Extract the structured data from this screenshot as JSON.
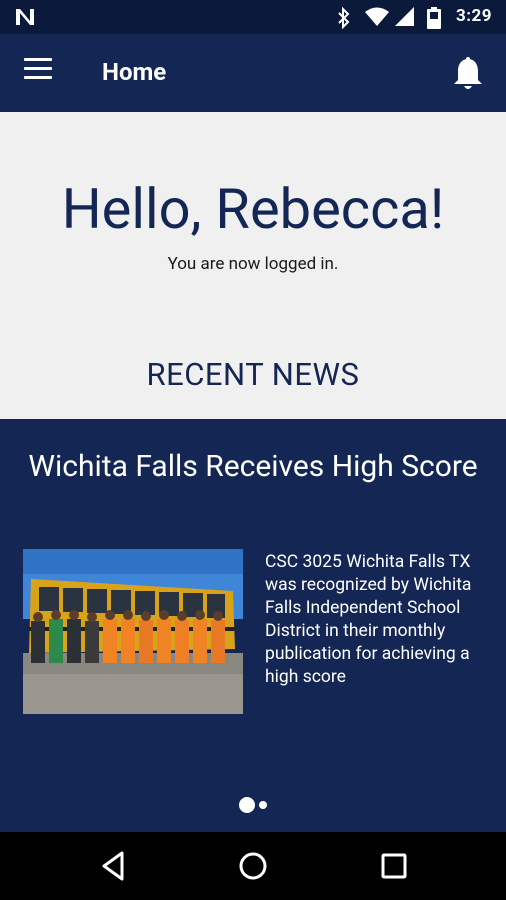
{
  "status_bar": {
    "time": "3:29",
    "icons": [
      "notification-n-icon",
      "bluetooth-icon",
      "wifi-icon",
      "cellular-signal-icon",
      "battery-icon"
    ]
  },
  "app_bar": {
    "title": "Home",
    "icons": [
      "hamburger-menu-icon",
      "bell-icon"
    ]
  },
  "hero": {
    "greeting": "Hello, Rebecca!",
    "subtitle": "You are now logged in.",
    "section_title": "RECENT NEWS"
  },
  "news": {
    "headline": "Wichita Falls Receives High Score",
    "body": "CSC 3025 Wichita Falls TX was recognized by Wichita Falls Independent School District in their monthly publication for achieving a high score",
    "pager": {
      "current": 1,
      "total": 2
    }
  },
  "nav_bar": {
    "icons": [
      "back-icon",
      "home-icon",
      "recents-icon"
    ]
  },
  "colors": {
    "primary": "#132654",
    "status_bar": "#0b1a3b",
    "background": "#f0f0f0",
    "nav_bar": "#000000"
  }
}
